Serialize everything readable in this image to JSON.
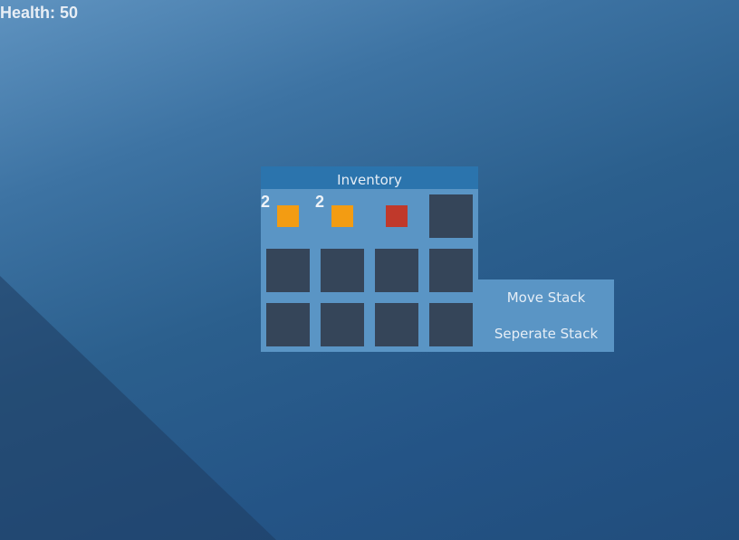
{
  "hud": {
    "health_label": "Health:",
    "health_value": "50"
  },
  "inventory": {
    "title": "Inventory",
    "slots": [
      {
        "item": "orange-item",
        "color": "#f39c12",
        "count": "2"
      },
      {
        "item": "orange-item",
        "color": "#f39c12",
        "count": "2"
      },
      {
        "item": "red-item",
        "color": "#c0392b",
        "count": ""
      },
      {
        "item": null
      },
      {
        "item": null
      },
      {
        "item": null
      },
      {
        "item": null
      },
      {
        "item": null
      },
      {
        "item": null
      },
      {
        "item": null
      },
      {
        "item": null
      },
      {
        "item": null
      }
    ]
  },
  "context_menu": {
    "items": [
      {
        "label": "Move Stack"
      },
      {
        "label": "Seperate Stack"
      }
    ]
  },
  "colors": {
    "panel": "#5a95c5",
    "header": "#2b74ad",
    "empty_slot": "#354559"
  }
}
